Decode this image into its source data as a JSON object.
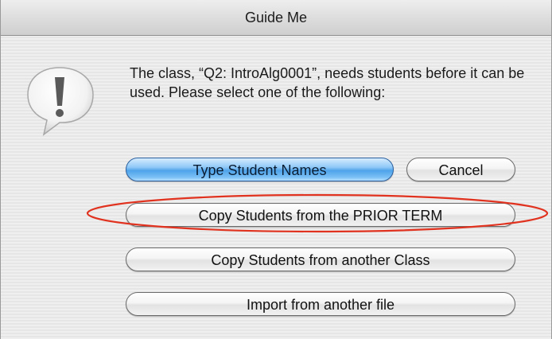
{
  "window": {
    "title": "Guide Me"
  },
  "icons": {
    "alert": "exclamation-speech-bubble-icon"
  },
  "message": {
    "text": "The class, “Q2: IntroAlg0001”, needs students before it can be used. Please select one of the following:"
  },
  "buttons": {
    "type_names": "Type Student Names",
    "cancel": "Cancel",
    "copy_prior_term": "Copy Students from the PRIOR TERM",
    "copy_another_class": "Copy Students from another Class",
    "import_file": "Import from another file"
  },
  "colors": {
    "default_button": "#4ea3ea",
    "highlight_annotation": "#e0321e"
  }
}
